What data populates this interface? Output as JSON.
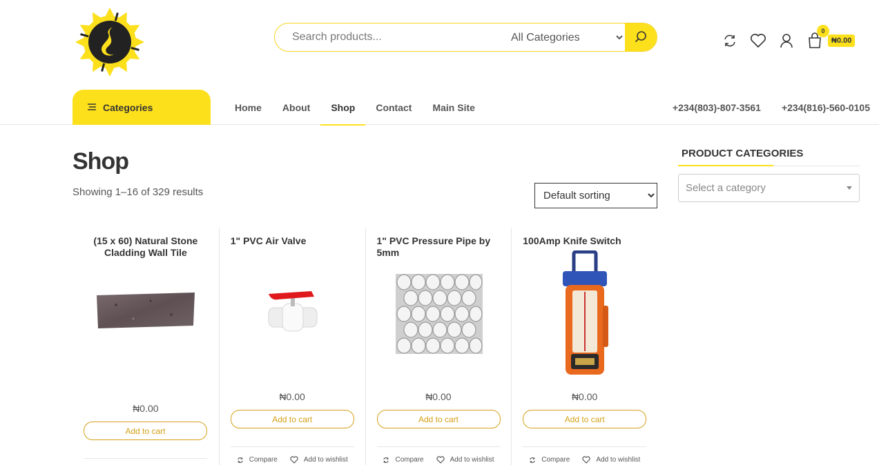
{
  "header": {
    "search_placeholder": "Search products...",
    "category_selected": "All Categories",
    "cart_count": "0",
    "cart_total": "₦0.00",
    "icons": [
      "compare-icon",
      "heart-icon",
      "user-icon",
      "cart-icon",
      "search-icon"
    ],
    "accent_color": "#fde01c"
  },
  "nav": {
    "categories_label": "Categories",
    "menu": [
      {
        "label": "Home"
      },
      {
        "label": "About"
      },
      {
        "label": "Shop"
      },
      {
        "label": "Contact"
      },
      {
        "label": "Main Site"
      }
    ],
    "phones": [
      "+234(803)-807-3561",
      "+234(816)-560-0105"
    ]
  },
  "main": {
    "title": "Shop",
    "results_text": "Showing 1–16 of 329 results",
    "sort_selected": "Default sorting"
  },
  "products": [
    {
      "title": "(15 x 60) Natural Stone Cladding Wall Tile",
      "price": "₦0.00",
      "button": "Add to cart",
      "compare": "",
      "wishlist": ""
    },
    {
      "title": "1\" PVC Air Valve",
      "price": "₦0.00",
      "button": "Add to cart",
      "compare": "Compare",
      "wishlist": "Add to wishlist"
    },
    {
      "title": "1\" PVC Pressure Pipe by 5mm",
      "price": "₦0.00",
      "button": "Add to cart",
      "compare": "Compare",
      "wishlist": "Add to wishlist"
    },
    {
      "title": "100Amp Knife Switch",
      "price": "₦0.00",
      "button": "Add to cart",
      "compare": "Compare",
      "wishlist": "Add to wishlist"
    }
  ],
  "sidebar": {
    "title": "PRODUCT CATEGORIES",
    "select_placeholder": "Select a category"
  }
}
